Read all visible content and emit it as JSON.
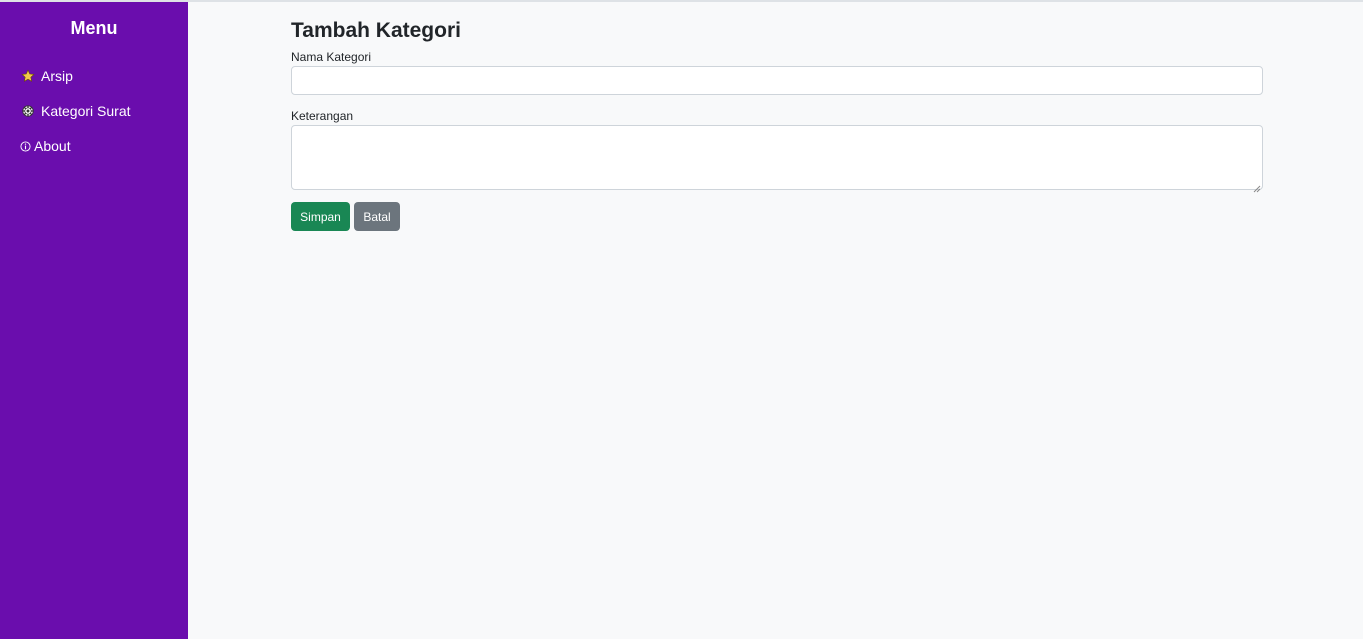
{
  "sidebar": {
    "title": "Menu",
    "items": [
      {
        "label": "Arsip",
        "icon": "star-icon"
      },
      {
        "label": "Kategori Surat",
        "icon": "gear-icon"
      },
      {
        "label": "About",
        "icon": "info-icon"
      }
    ]
  },
  "main": {
    "title": "Tambah Kategori",
    "form": {
      "name_label": "Nama Kategori",
      "name_value": "",
      "description_label": "Keterangan",
      "description_value": ""
    },
    "buttons": {
      "save_label": "Simpan",
      "cancel_label": "Batal"
    }
  },
  "colors": {
    "sidebar": "#6a0dad",
    "save_button": "#198754",
    "cancel_button": "#6c757d",
    "background": "#f8f9fa"
  }
}
